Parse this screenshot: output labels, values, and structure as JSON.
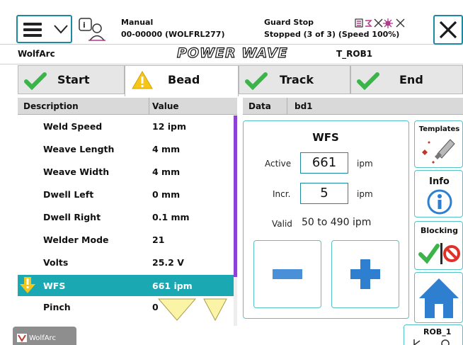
{
  "header": {
    "mode": "Manual",
    "program": "00-00000 (WOLFRL277)",
    "guard": "Guard Stop",
    "state": "Stopped (3 of 3) (Speed 100%)"
  },
  "title_row": {
    "app_name": "WolfArc",
    "logo": "POWER WAVE",
    "task": "T_ROB1"
  },
  "tabs": [
    {
      "label": "Start",
      "icon": "checkmark-icon"
    },
    {
      "label": "Bead",
      "icon": "warning-icon"
    },
    {
      "label": "Track",
      "icon": "checkmark-icon"
    },
    {
      "label": "End",
      "icon": "checkmark-icon"
    }
  ],
  "table": {
    "headers": {
      "description": "Description",
      "value": "Value"
    },
    "rows": [
      {
        "description": "Weld Speed",
        "value": "12 ipm"
      },
      {
        "description": "Weave Length",
        "value": "4 mm"
      },
      {
        "description": "Weave Width",
        "value": "4 mm"
      },
      {
        "description": "Dwell Left",
        "value": "0 mm"
      },
      {
        "description": "Dwell Right",
        "value": "0.1 mm"
      },
      {
        "description": "Welder Mode",
        "value": "21"
      },
      {
        "description": "Volts",
        "value": "25.2 V"
      },
      {
        "description": "WFS",
        "value": "661 ipm"
      },
      {
        "description": "Pinch",
        "value": "0"
      }
    ]
  },
  "data_panel": {
    "data_label": "Data",
    "data_value": "bd1",
    "title": "WFS",
    "active_label": "Active",
    "active_value": "661",
    "active_unit": "ipm",
    "incr_label": "Incr.",
    "incr_value": "5",
    "incr_unit": "ipm",
    "valid_label": "Valid",
    "valid_range": "50 to 490 ipm"
  },
  "side_buttons": {
    "templates": "Templates",
    "info": "Info",
    "blocking": "Blocking"
  },
  "bottom": {
    "taskbar_label": "WolfArc",
    "robot_label": "ROB_1"
  },
  "colors": {
    "accent": "#1e88a0",
    "selected_row": "#1aa8b3",
    "check_green": "#3bb54a",
    "warning_yellow": "#f5c518",
    "minus_blue": "#4a90d9",
    "plus_blue": "#2f7fd1",
    "scroll_purple": "#8a43d6"
  }
}
